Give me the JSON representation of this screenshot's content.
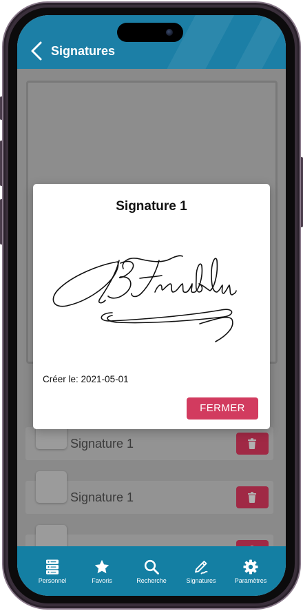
{
  "header": {
    "title": "Signatures",
    "back_icon": "chevron-left-icon"
  },
  "list": {
    "items": [
      {
        "label": "Signature 1",
        "delete_icon": "trash-icon"
      },
      {
        "label": "Signature 1",
        "delete_icon": "trash-icon"
      },
      {
        "delete_icon": "trash-icon"
      }
    ]
  },
  "modal": {
    "title": "Signature 1",
    "created_label": "Créer le:",
    "created_date": "2021-05-01",
    "close_button": "FERMER"
  },
  "tabbar": {
    "items": [
      {
        "label": "Personnel",
        "icon": "personnel-icon"
      },
      {
        "label": "Favoris",
        "icon": "star-icon"
      },
      {
        "label": "Recherche",
        "icon": "search-icon"
      },
      {
        "label": "Signatures",
        "icon": "signature-pen-icon"
      },
      {
        "label": "Paramètres",
        "icon": "gear-icon"
      }
    ]
  },
  "colors": {
    "header": "#1c7fa6",
    "tabbar": "#147fa3",
    "accent": "#d23b5f",
    "delete": "#e63c64"
  }
}
